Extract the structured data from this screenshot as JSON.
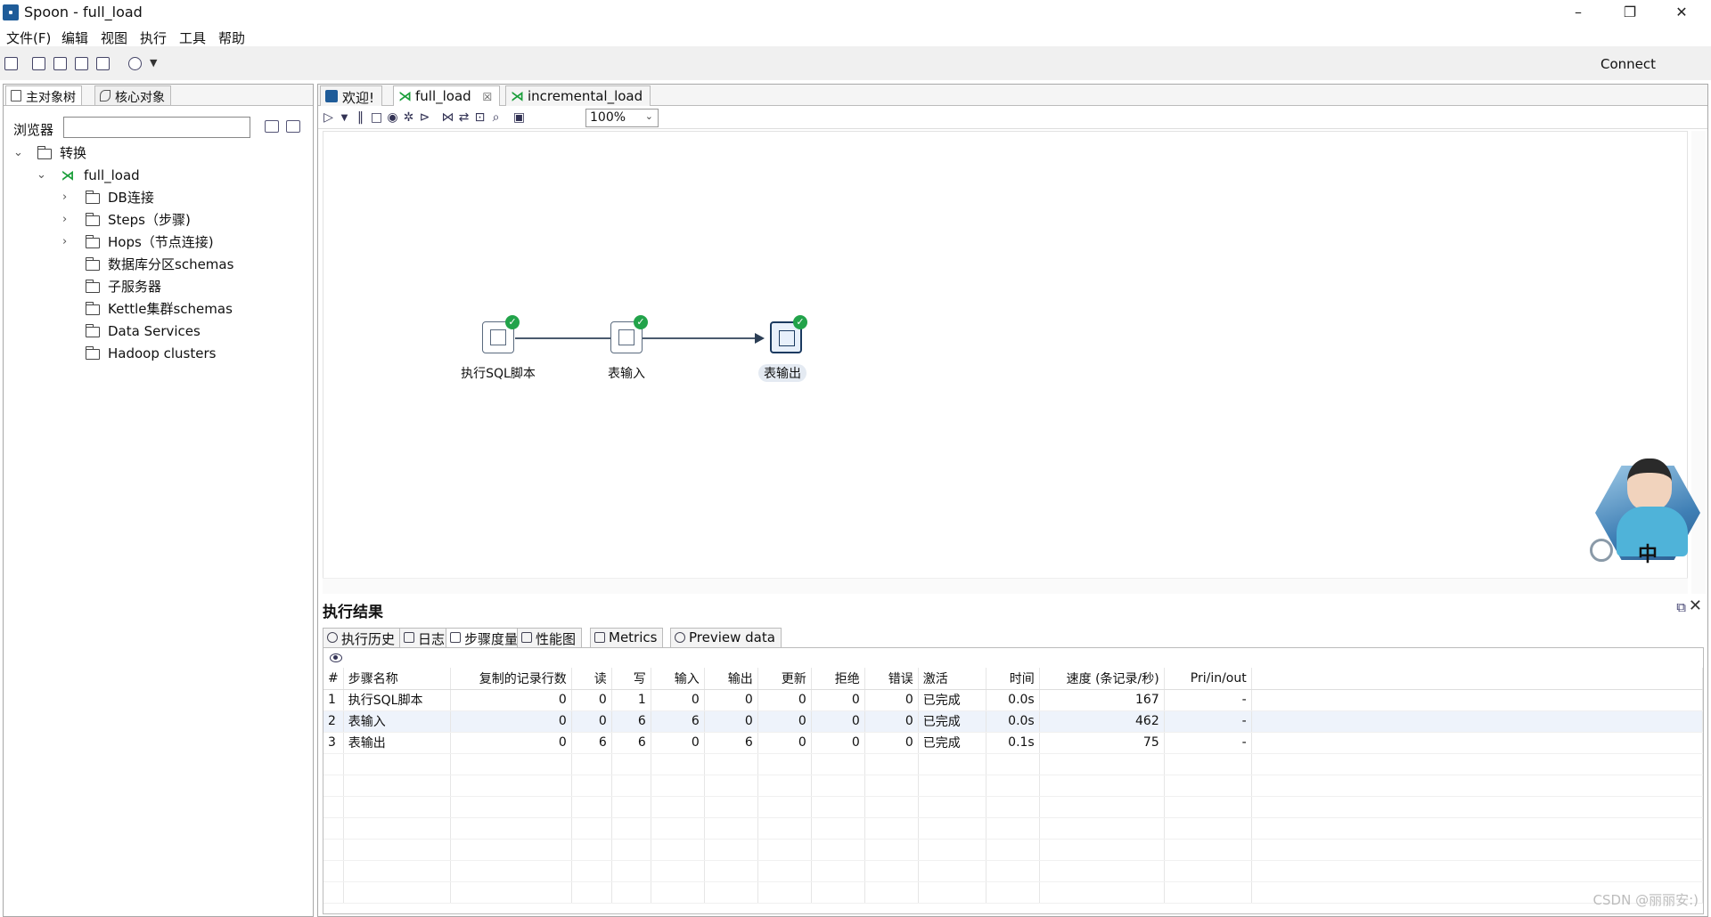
{
  "window": {
    "title": "Spoon - full_load",
    "minimize": "–",
    "restore": "❐",
    "close": "✕"
  },
  "menu": [
    "文件(F)",
    "编辑",
    "视图",
    "执行",
    "工具",
    "帮助"
  ],
  "toolbar": {
    "connect_label": "Connect"
  },
  "left_panel": {
    "tabs": [
      "主对象树",
      "核心对象"
    ],
    "browser_label": "浏览器",
    "browser_value": "",
    "tree": {
      "root_label": "转换",
      "transformation_label": "full_load",
      "children": [
        "DB连接",
        "Steps（步骤)",
        "Hops（节点连接)",
        "数据库分区schemas",
        "子服务器",
        "Kettle集群schemas",
        "Data Services",
        "Hadoop clusters"
      ]
    }
  },
  "editor": {
    "tabs": [
      "欢迎!",
      "full_load",
      "incremental_load"
    ],
    "active_tab": "full_load",
    "zoom": "100%",
    "steps": [
      {
        "label": "执行SQL脚本",
        "status": "done"
      },
      {
        "label": "表输入",
        "status": "done"
      },
      {
        "label": "表输出",
        "status": "done",
        "selected": true
      }
    ]
  },
  "results": {
    "title": "执行结果",
    "tabs": [
      "执行历史",
      "日志",
      "步骤度量",
      "性能图",
      "Metrics",
      "Preview data"
    ],
    "active_tab": "步骤度量",
    "columns": [
      "#",
      "步骤名称",
      "复制的记录行数",
      "读",
      "写",
      "输入",
      "输出",
      "更新",
      "拒绝",
      "错误",
      "激活",
      "时间",
      "速度 (条记录/秒)",
      "Pri/in/out"
    ],
    "rows": [
      [
        "1",
        "执行SQL脚本",
        "0",
        "0",
        "1",
        "0",
        "0",
        "0",
        "0",
        "0",
        "已完成",
        "0.0s",
        "167",
        "-"
      ],
      [
        "2",
        "表输入",
        "0",
        "0",
        "6",
        "6",
        "0",
        "0",
        "0",
        "0",
        "已完成",
        "0.0s",
        "462",
        "-"
      ],
      [
        "3",
        "表输出",
        "0",
        "6",
        "6",
        "0",
        "6",
        "0",
        "0",
        "0",
        "已完成",
        "0.1s",
        "75",
        "-"
      ]
    ]
  },
  "avatar_widget": {
    "char": "中"
  },
  "watermark": "CSDN @丽丽安:)"
}
